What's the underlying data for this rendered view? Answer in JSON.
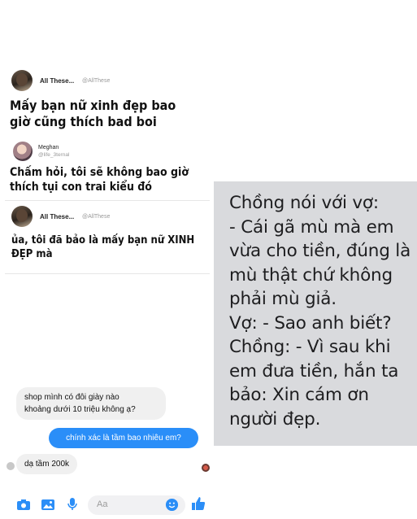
{
  "tweets": [
    {
      "name": "All These...",
      "handle": "@AllThese",
      "text": "Mấy bạn nữ xinh đẹp bao giờ cũng thích bad boi"
    },
    {
      "name": "Meghan",
      "handle": "@life_3ternal",
      "text": "Chấm hỏi, tôi sẽ không bao giờ thích tụi con trai kiểu đó"
    },
    {
      "name": "All These...",
      "handle": "@AllThese",
      "text": "ủa, tôi đã bảo là mấy bạn nữ XINH ĐẸP mà"
    }
  ],
  "meme": {
    "text": "Chồng nói với vợ:\n- Cái gã mù mà em vừa cho tiền, đúng là mù thật chứ không phải mù giả.\nVợ: - Sao anh biết?\nChồng: - Vì sau khi em đưa tiền, hắn ta bảo: Xin cám ơn người đẹp."
  },
  "chat": {
    "messages": [
      {
        "direction": "in",
        "text": "shop mình có đôi giày nào\nkhoảng dưới 10 triệu không ạ?"
      },
      {
        "direction": "out",
        "text": "chính xác là tầm bao nhiêu em?"
      },
      {
        "direction": "in",
        "text": "dạ tầm 200k"
      }
    ],
    "accent": "#2a8ef8",
    "input_placeholder": "Aa",
    "toolbar_icons": [
      "camera-icon",
      "image-icon",
      "microphone-icon",
      "emoji-icon",
      "thumbs-up-icon"
    ]
  }
}
